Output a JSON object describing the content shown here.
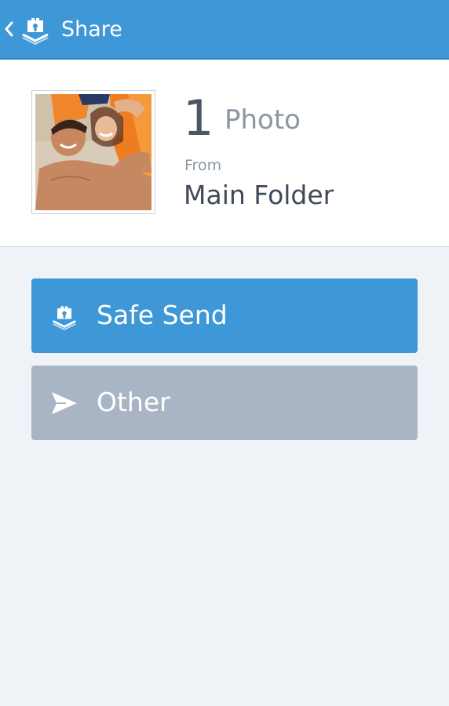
{
  "header": {
    "title": "Share",
    "back_icon": "chevron-left-icon",
    "app_icon": "safe-vault-icon",
    "background": "#3e97d6"
  },
  "summary": {
    "count": "1",
    "count_label": "Photo",
    "from_label": "From",
    "folder": "Main Folder",
    "thumbnail_icon": "photo-thumbnail"
  },
  "actions": [
    {
      "label": "Safe Send",
      "icon": "safe-vault-icon",
      "color": "#3e97d6"
    },
    {
      "label": "Other",
      "icon": "send-icon",
      "color": "#a9b5c5"
    }
  ]
}
